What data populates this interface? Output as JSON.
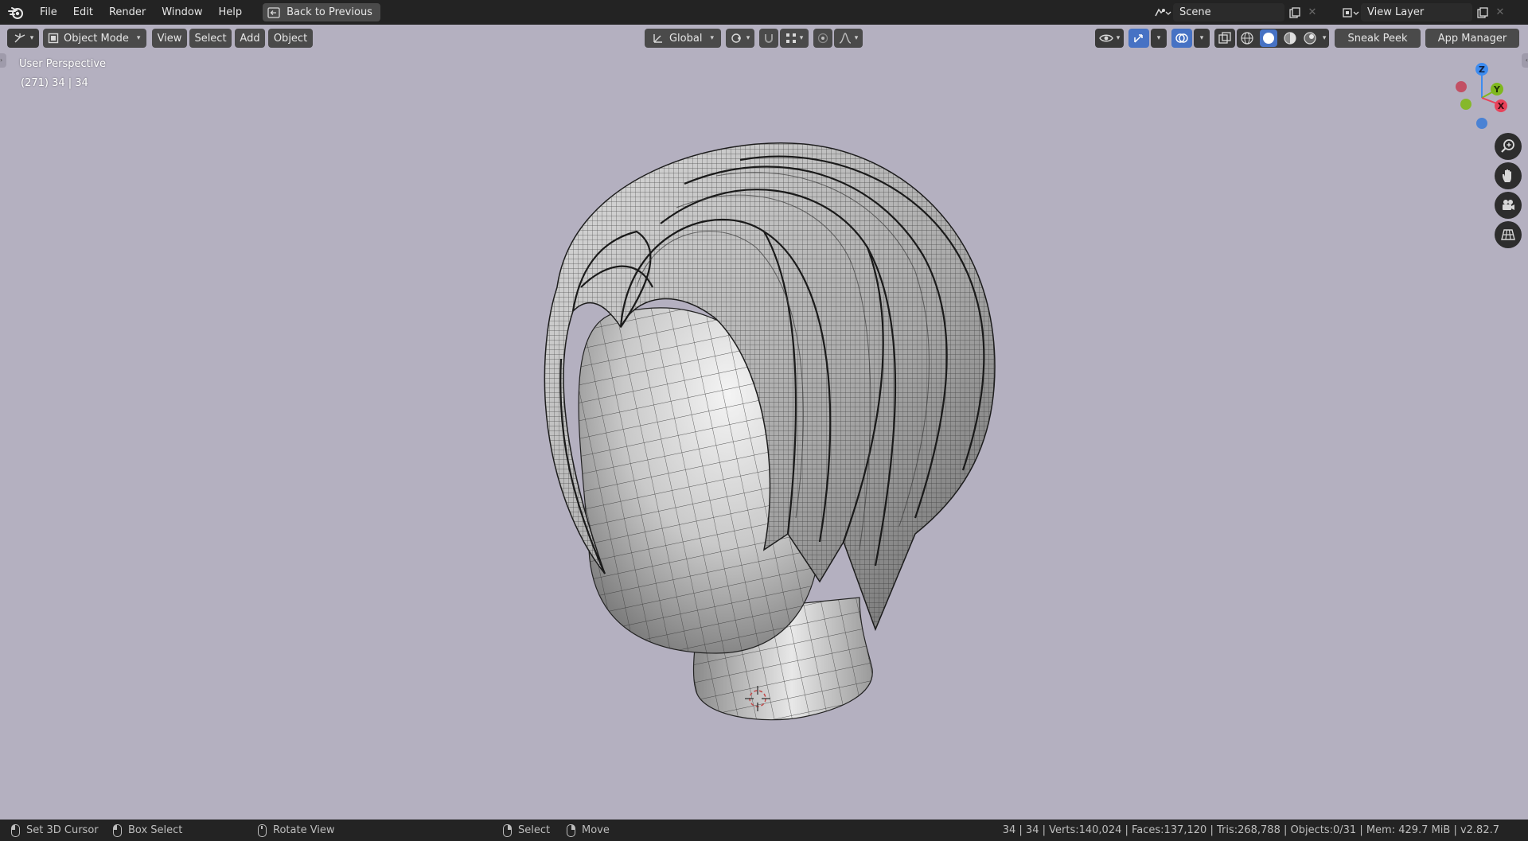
{
  "menu": {
    "items": [
      "File",
      "Edit",
      "Render",
      "Window",
      "Help"
    ],
    "back_label": "Back to Previous"
  },
  "workspace": {
    "scene_label": "Scene",
    "view_layer_label": "View Layer"
  },
  "viewport_header": {
    "mode_label": "Object Mode",
    "menus": [
      "View",
      "Select",
      "Add",
      "Object"
    ],
    "transform_orientation": "Global",
    "sneak_peek_label": "Sneak Peek",
    "app_manager_label": "App Manager"
  },
  "overlay": {
    "view_name": "User Perspective",
    "collection_info": "(271) 34 | 34"
  },
  "gizmo": {
    "axis_z": "Z",
    "axis_y": "Y",
    "axis_x": "X"
  },
  "statusbar": {
    "hints": [
      "Set 3D Cursor",
      "Box Select",
      "Rotate View",
      "Select",
      "Move"
    ],
    "stats": "34 | 34 | Verts:140,024 | Faces:137,120 | Tris:268,788 | Objects:0/31 | Mem: 429.7 MiB | v2.82.7"
  },
  "colors": {
    "viewport_bg": "#b4b0c0",
    "header_button": "#4a4a4a",
    "active_blue": "#4672c4",
    "axis_x": "#e8425a",
    "axis_y": "#7fb81e",
    "axis_z": "#3d8cf0"
  },
  "icons": [
    "blender-logo-icon",
    "editor-type-icon",
    "object-mode-icon",
    "transform-orientation-icon",
    "pivot-icon",
    "snap-icon",
    "proportional-icon",
    "visibility-icon",
    "gizmo-icon",
    "overlay-icon",
    "xray-icon",
    "wireframe-shading-icon",
    "solid-shading-icon",
    "material-shading-icon",
    "rendered-shading-icon",
    "zoom-icon",
    "hand-pan-icon",
    "camera-icon",
    "grid-icon",
    "3d-cursor-icon"
  ]
}
